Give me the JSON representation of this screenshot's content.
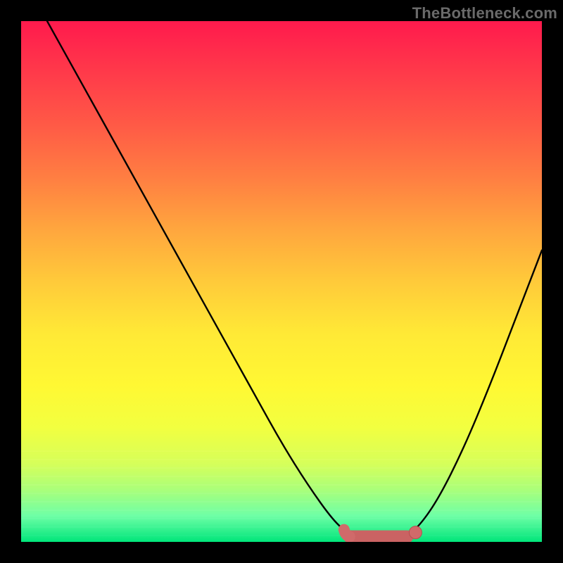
{
  "credit_text": "TheBottleneck.com",
  "colors": {
    "page_bg": "#000000",
    "curve": "#000000",
    "marker_fill": "#d06a6a",
    "marker_stroke": "#b84e4e"
  },
  "chart_data": {
    "type": "line",
    "title": "",
    "xlabel": "",
    "ylabel": "",
    "xlim": [
      0,
      100
    ],
    "ylim": [
      0,
      100
    ],
    "grid": false,
    "legend": false,
    "series": [
      {
        "name": "curve",
        "x": [
          5,
          10,
          15,
          20,
          25,
          30,
          35,
          40,
          45,
          50,
          55,
          60,
          63,
          65,
          68,
          70,
          72,
          74,
          76,
          80,
          85,
          90,
          95,
          100
        ],
        "y": [
          100,
          91,
          82,
          73,
          64,
          55,
          46,
          37,
          28,
          19,
          11,
          4,
          1.5,
          1,
          0.8,
          1,
          1.2,
          1.5,
          2.5,
          8,
          18,
          30,
          43,
          56
        ]
      }
    ],
    "flat_segment": {
      "comment": "approximate x-range where the curve is at its minimum (the pink highlighted band)",
      "x_start": 62,
      "x_end": 76,
      "y": 1
    },
    "gradient_stops": [
      {
        "pos": 0,
        "color": "#ff1a4d"
      },
      {
        "pos": 50,
        "color": "#ffca3a"
      },
      {
        "pos": 78,
        "color": "#f2ff40"
      },
      {
        "pos": 100,
        "color": "#00e57a"
      }
    ]
  }
}
